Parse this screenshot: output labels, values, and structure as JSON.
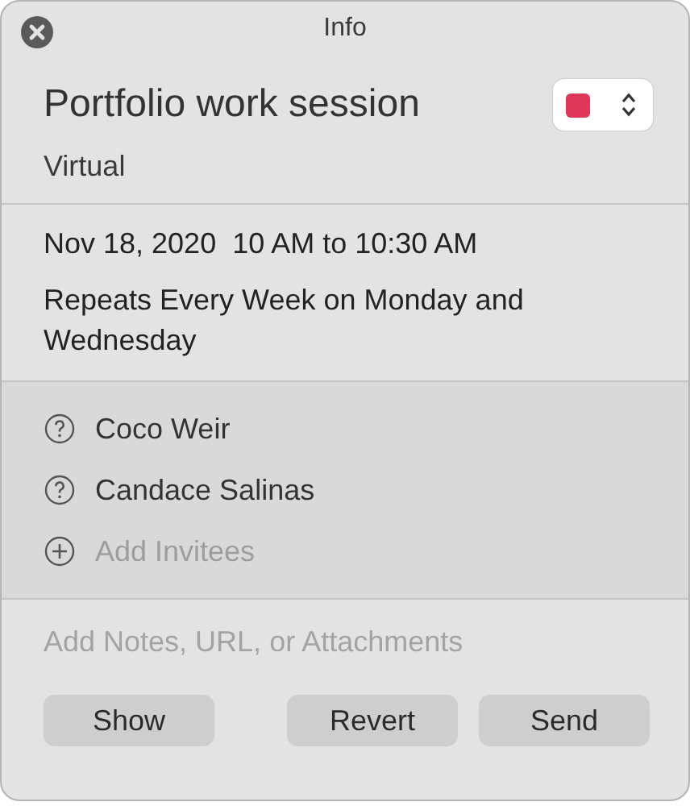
{
  "window": {
    "title": "Info"
  },
  "event": {
    "title": "Portfolio work session",
    "location": "Virtual",
    "color": "#e0365a"
  },
  "schedule": {
    "datetime": "Nov 18, 2020  10 AM to 10:30 AM",
    "repeat": "Repeats Every Week on Monday and Wednesday"
  },
  "invitees": [
    {
      "kind": "invitee",
      "name": "Coco Weir"
    },
    {
      "kind": "invitee",
      "name": "Candace Salinas"
    },
    {
      "kind": "add",
      "name": "Add Invitees"
    }
  ],
  "notes": {
    "placeholder": "Add Notes, URL, or Attachments"
  },
  "buttons": [
    "Show",
    "Revert",
    "Send"
  ]
}
